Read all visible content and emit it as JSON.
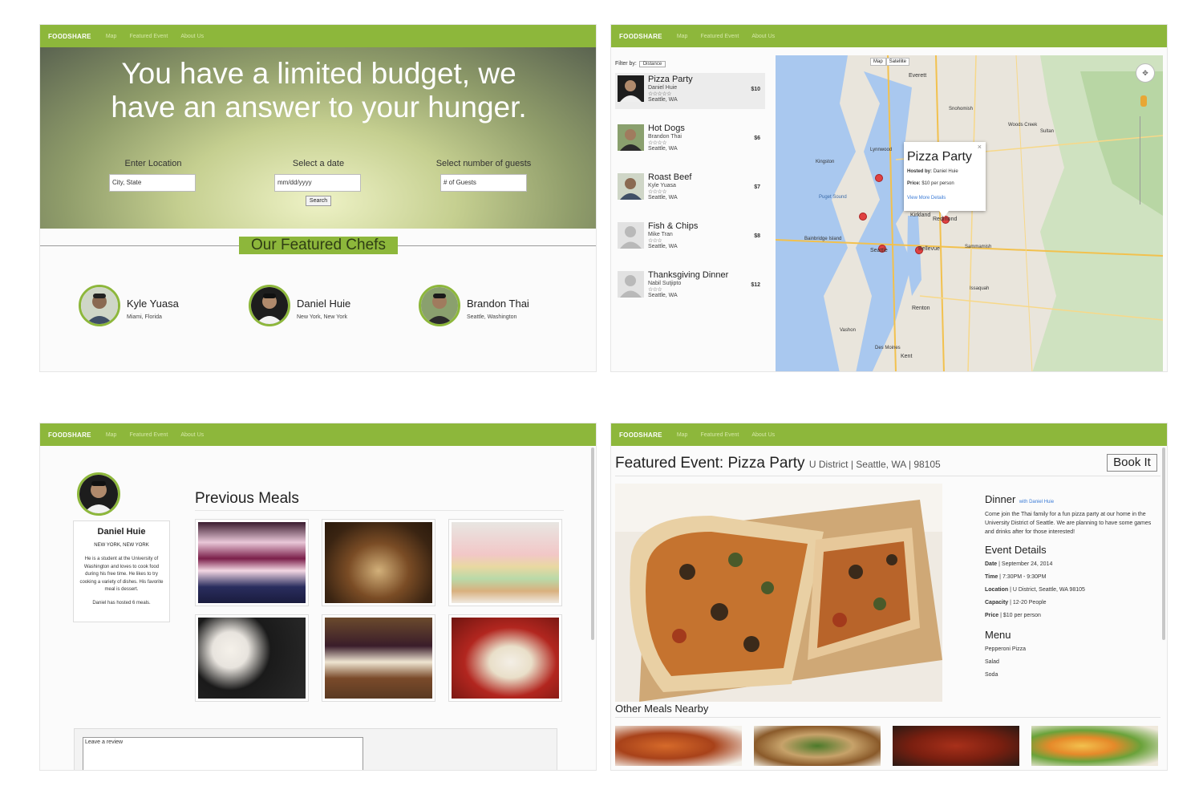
{
  "nav": {
    "brand": "FOODSHARE",
    "links": [
      "Map",
      "Featured Event",
      "About Us"
    ]
  },
  "landing": {
    "headline": "You have a limited budget, we have an answer to your hunger.",
    "location_label": "Enter Location",
    "location_placeholder": "City, State",
    "date_label": "Select a date",
    "date_placeholder": "mm/dd/yyyy",
    "guests_label": "Select number of guests",
    "guests_placeholder": "# of Guests",
    "search_label": "Search",
    "featured_title": "Our Featured Chefs",
    "chefs": [
      {
        "name": "Kyle Yuasa",
        "location": "Miami, Florida"
      },
      {
        "name": "Daniel Huie",
        "location": "New York, New York"
      },
      {
        "name": "Brandon Thai",
        "location": "Seattle, Washington"
      }
    ]
  },
  "map_page": {
    "filter_label": "Filter by:",
    "filter_value": "Distance",
    "map_tabs": [
      "Map",
      "Satellite"
    ],
    "meals": [
      {
        "title": "Pizza Party",
        "host": "Daniel Huie",
        "stars": "☆☆☆☆☆",
        "city": "Seattle, WA",
        "price": "$10"
      },
      {
        "title": "Hot Dogs",
        "host": "Brandon Thai",
        "stars": "☆☆☆☆",
        "city": "Seattle, WA",
        "price": "$6"
      },
      {
        "title": "Roast Beef",
        "host": "Kyle Yuasa",
        "stars": "☆☆☆☆",
        "city": "Seattle, WA",
        "price": "$7"
      },
      {
        "title": "Fish & Chips",
        "host": "Mike Tran",
        "stars": "☆☆☆",
        "city": "Seattle, WA",
        "price": "$8"
      },
      {
        "title": "Thanksgiving Dinner",
        "host": "Nabil Sutjipto",
        "stars": "☆☆☆",
        "city": "Seattle, WA",
        "price": "$12"
      }
    ],
    "info": {
      "title": "Pizza Party",
      "hosted_label": "Hosted by:",
      "hosted_value": "Daniel Huie",
      "price_label": "Price:",
      "price_value": "$10 per person",
      "link": "View More Details",
      "close": "×"
    },
    "place_labels": [
      "Everett",
      "Lynnwood",
      "Kirkland",
      "Redmond",
      "Seattle",
      "Bellevue",
      "Renton",
      "Kent",
      "Sammamish",
      "Issaquah",
      "Bothell",
      "Shoreline",
      "Mukilteo",
      "Snohomish",
      "Vashon",
      "Des Moines",
      "Burien",
      "Woods Creek",
      "Sultan",
      "Preston",
      "Hobart",
      "Covington",
      "Maple Valley",
      "Bainbridge Island",
      "Kingston",
      "Puget Sound",
      "Port Orchard"
    ]
  },
  "profile": {
    "name": "Daniel Huie",
    "location": "NEW YORK, NEW YORK",
    "bio": "He is a student at the University of Washington and loves to cook food during his free time. He likes to try cooking a variety of dishes. His favorite meal is dessert.",
    "hosted": "Daniel has hosted 6 meals.",
    "previous_meals_title": "Previous Meals",
    "review_placeholder": "Leave a review"
  },
  "event": {
    "title": "Featured Event: Pizza Party",
    "subtitle": "U District | Seattle, WA | 98105",
    "book_label": "Book It",
    "dinner_heading": "Dinner",
    "dinner_with": "with Daniel Huie",
    "description": "Come join the Thai family for a fun pizza party at our home in the University District of Seattle. We are planning to have some games and drinks after for those interested!",
    "details_heading": "Event Details",
    "details": [
      {
        "label": "Date",
        "value": "September 24, 2014"
      },
      {
        "label": "Time",
        "value": "7:30PM - 9:30PM"
      },
      {
        "label": "Location",
        "value": "U District, Seattle, WA 98105"
      },
      {
        "label": "Capacity",
        "value": "12-20 People"
      },
      {
        "label": "Price",
        "value": "$10 per person"
      }
    ],
    "menu_heading": "Menu",
    "menu": [
      "Pepperoni Pizza",
      "Salad",
      "Soda"
    ],
    "other_meals_heading": "Other Meals Nearby"
  },
  "colors": {
    "accent": "#8db73b",
    "link": "#3b7bd6",
    "marker": "#e04141"
  }
}
